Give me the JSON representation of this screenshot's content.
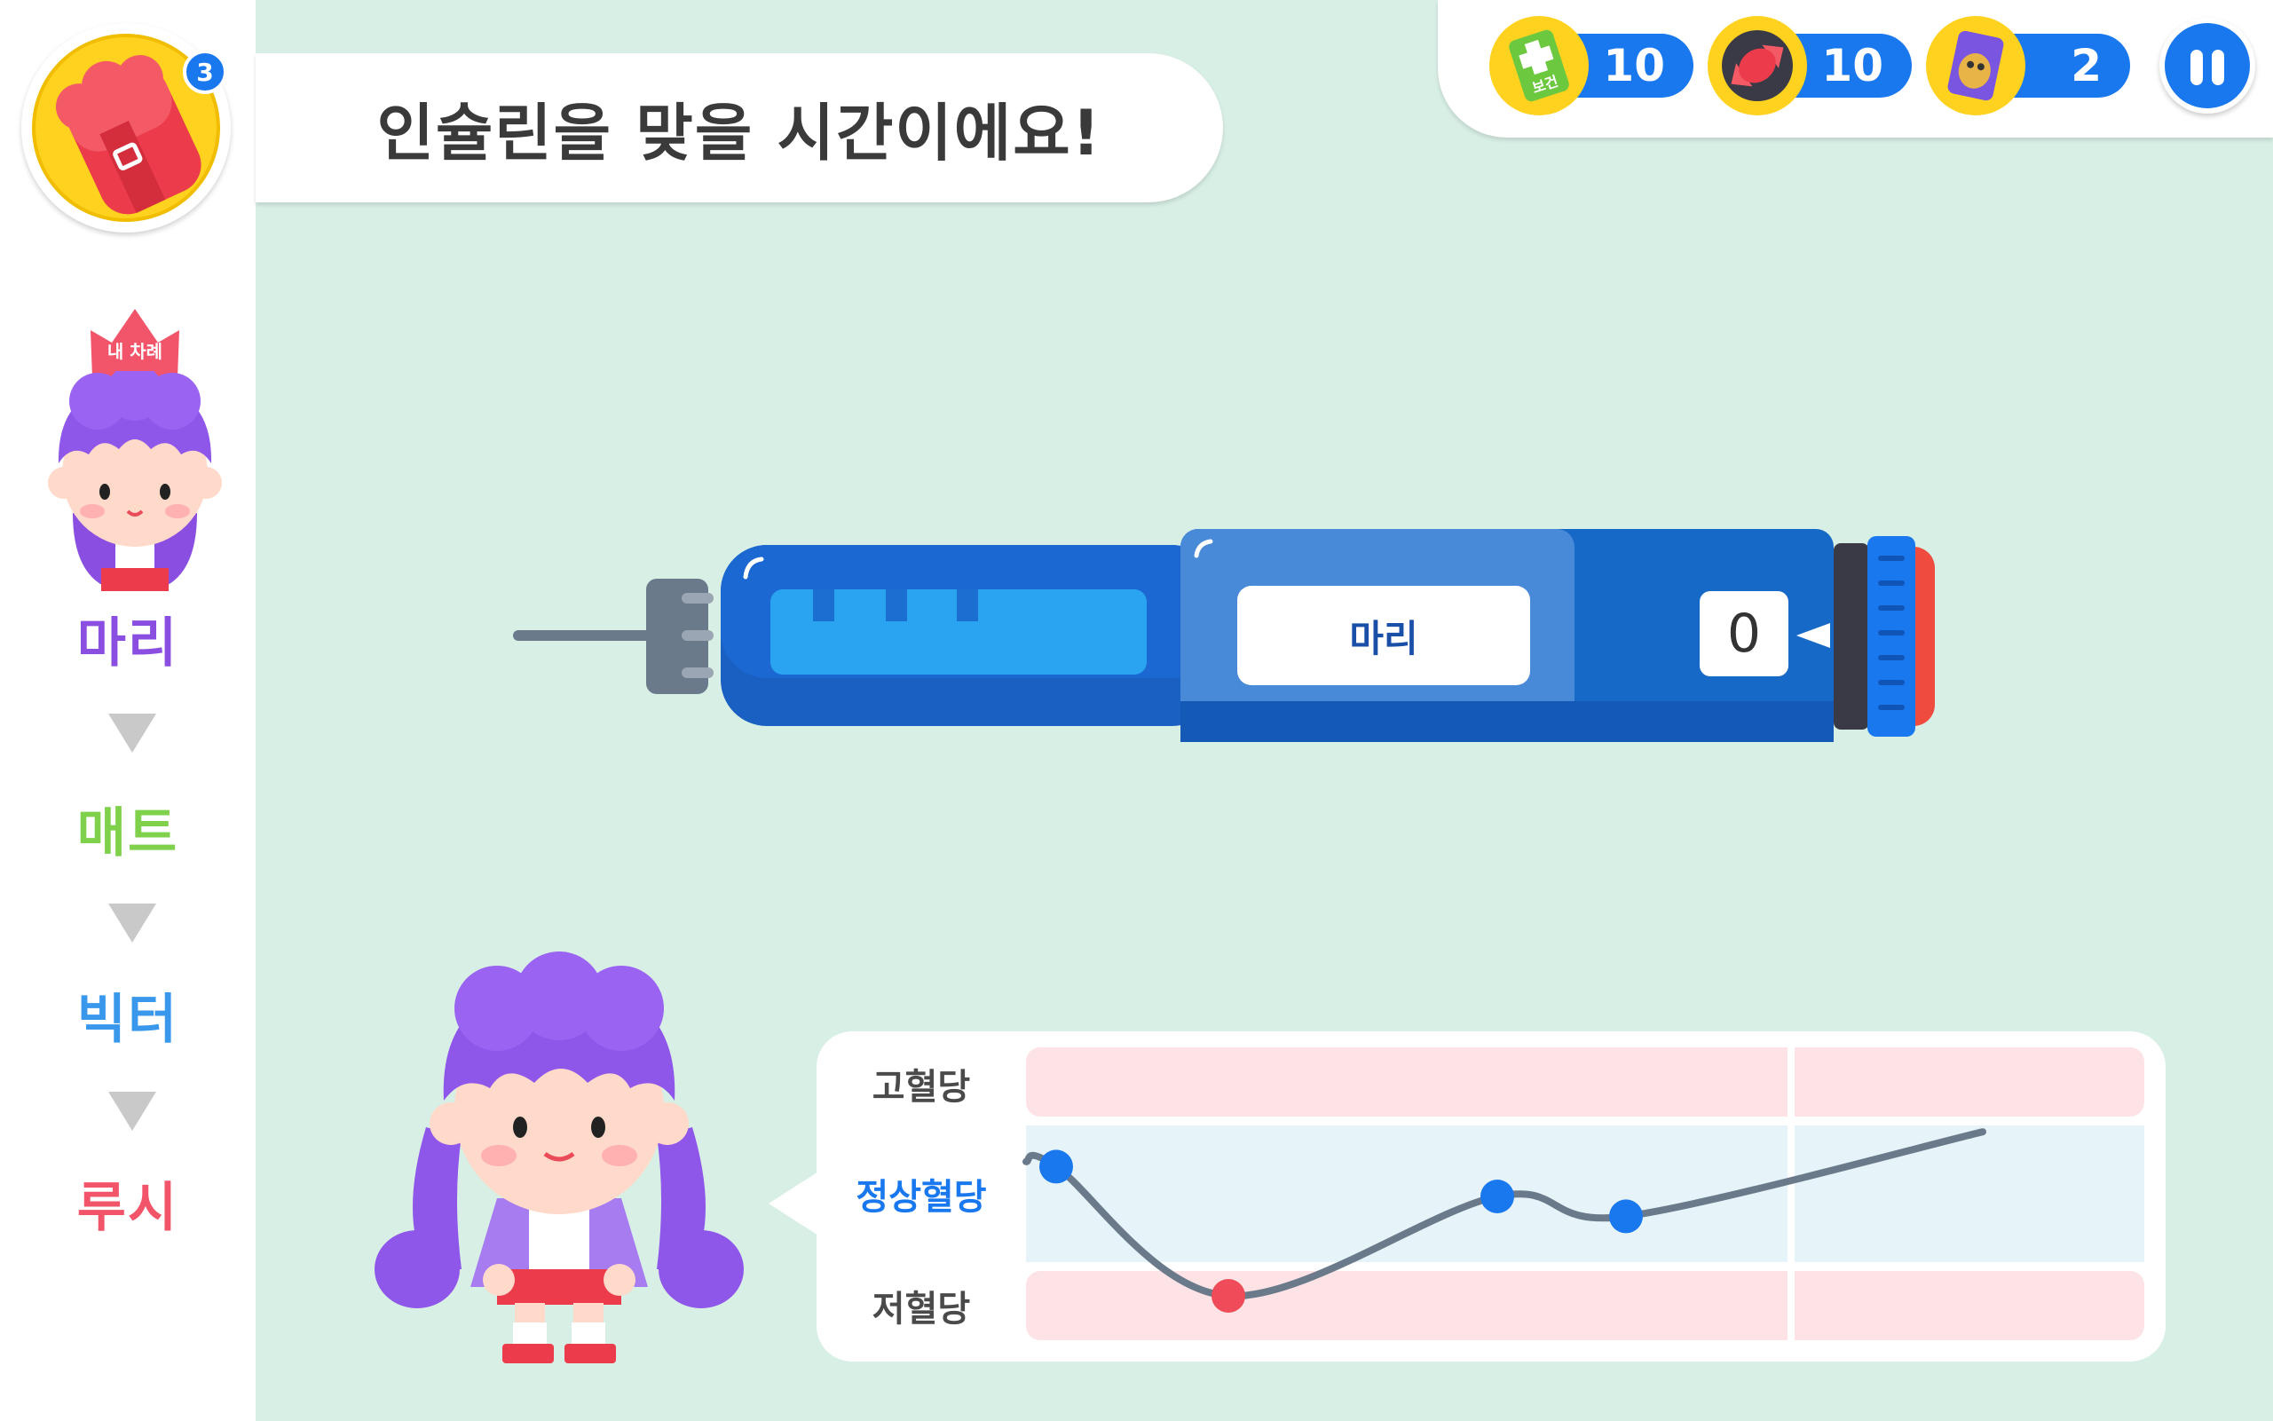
{
  "header": {
    "title": "인슐린을 맞을 시간이에요!"
  },
  "bag": {
    "badge_count": "3"
  },
  "turn_order": {
    "current_label": "내 차례",
    "players": [
      {
        "name": "마리",
        "color": "#8a4fe0"
      },
      {
        "name": "매트",
        "color": "#7fd14c"
      },
      {
        "name": "빅터",
        "color": "#3a98ec"
      },
      {
        "name": "루시",
        "color": "#f2546a"
      }
    ]
  },
  "resources": [
    {
      "icon": "health-card-icon",
      "icon_text": "보건",
      "value": "10"
    },
    {
      "icon": "candy-icon",
      "value": "10"
    },
    {
      "icon": "monster-card-icon",
      "value": "2"
    }
  ],
  "pen": {
    "player_name": "마리",
    "dose": "0"
  },
  "glucose_chart": {
    "bands": [
      {
        "label": "고혈당",
        "color": "#4a4a4a"
      },
      {
        "label": "정상혈당",
        "color": "#1a78ef"
      },
      {
        "label": "저혈당",
        "color": "#4a4a4a"
      }
    ],
    "colors": {
      "high": "#fde3e5",
      "normal": "#e6f4f9",
      "low": "#fde3e5",
      "line": "#6b7a8b",
      "point": "#1a78ef",
      "low_point": "#ef4b58"
    }
  },
  "chart_data": {
    "type": "line",
    "title": "",
    "xlabel": "",
    "ylabel": "",
    "y_categories": [
      "저혈당",
      "정상혈당",
      "고혈당"
    ],
    "series": [
      {
        "x": [
          0,
          1,
          2,
          3
        ],
        "y": [
          1.2,
          -0.1,
          0.9,
          0.7
        ]
      }
    ],
    "ylim": [
      -0.6,
      2.4
    ],
    "grid": true
  }
}
